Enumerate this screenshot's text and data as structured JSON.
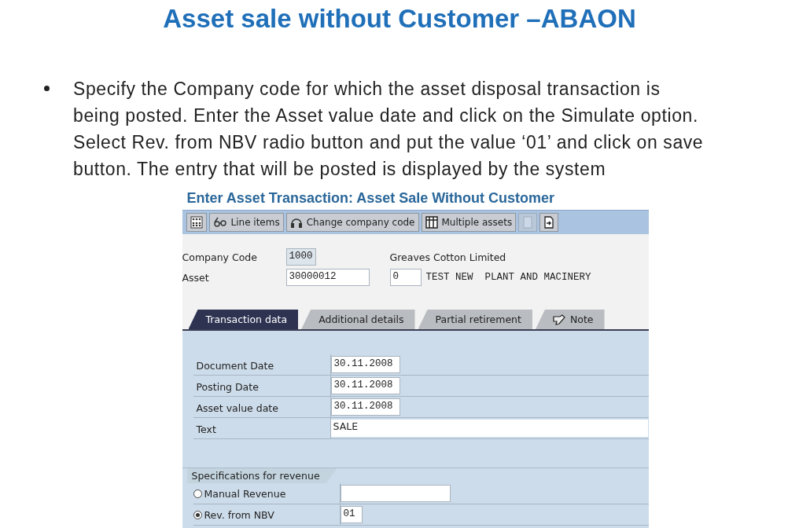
{
  "slide_title": "Asset sale without Customer –ABAON",
  "bullet": {
    "lines": [
      "Specify the Company code for which the asset disposal transaction is",
      "being posted. Enter the Asset value date and click on the Simulate option.",
      "Select Rev. from NBV radio button and put the value ‘01’ and click on save",
      "button. The entry that will be posted is displayed by the system"
    ]
  },
  "screen": {
    "title": "Enter Asset Transaction: Asset Sale Without Customer",
    "toolbar": [
      {
        "kind": "icon",
        "disabled": false
      },
      {
        "kind": "labeled",
        "label": "Line items",
        "disabled": false
      },
      {
        "kind": "labeled",
        "label": "Change company code",
        "disabled": false
      },
      {
        "kind": "labeled",
        "label": "Multiple assets",
        "disabled": false
      },
      {
        "kind": "icon",
        "disabled": true
      },
      {
        "kind": "icon",
        "disabled": false
      }
    ],
    "company_code": {
      "label": "Company Code",
      "value": "1000",
      "name": "Greaves Cotton Limited"
    },
    "asset": {
      "label": "Asset",
      "value": "30000012",
      "sub_number": "0",
      "description": "TEST NEW  PLANT AND MACINERY"
    },
    "tabs": [
      {
        "label": "Transaction data",
        "selected": true
      },
      {
        "label": "Additional details",
        "selected": false
      },
      {
        "label": "Partial retirement",
        "selected": false
      },
      {
        "label": "Note",
        "selected": false
      }
    ],
    "fields": [
      {
        "label": "Document Date",
        "value": "30.11.2008",
        "kind": "date"
      },
      {
        "label": "Posting Date",
        "value": "30.11.2008",
        "kind": "date"
      },
      {
        "label": "Asset value date",
        "value": "30.11.2008",
        "kind": "date"
      },
      {
        "label": "Text",
        "value": "SALE",
        "kind": "text"
      }
    ],
    "revenue": {
      "title": "Specifications for revenue",
      "options": [
        {
          "label": "Manual Revenue",
          "selected": false
        },
        {
          "label": "Rev. from NBV",
          "selected": true,
          "value": "01"
        }
      ]
    }
  }
}
